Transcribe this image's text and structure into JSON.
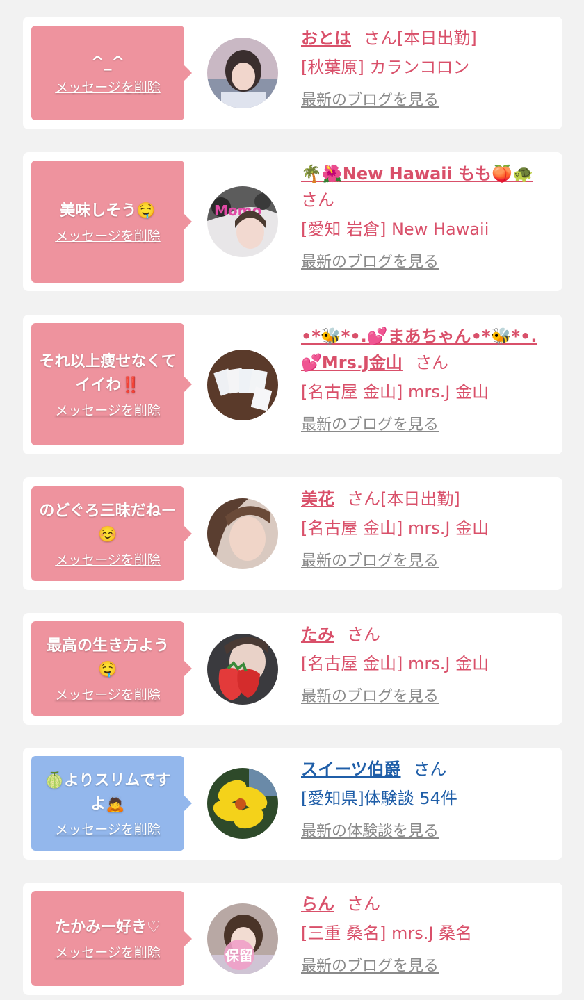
{
  "delete_label": "メッセージを削除",
  "colors": {
    "pink_bubble": "#ee939e",
    "blue_bubble": "#93b7ec",
    "pink_text": "#d9506a",
    "blue_text": "#1f5ea8",
    "link_gray": "#8a8a8a"
  },
  "cards": [
    {
      "message": "^_^",
      "name": "おとは",
      "suffix": "さん[本日出勤]",
      "shop": "[秋葉原] カランコロン",
      "blog": "最新のブログを見る",
      "theme": "pink",
      "avatar": "photo-girl-icon"
    },
    {
      "message": "美味しそう🤤",
      "name": "🌴🌺New Hawaii もも🍑🐢",
      "suffix": "さん",
      "shop": "[愛知 岩倉] New Hawaii",
      "blog": "最新のブログを見る",
      "theme": "pink",
      "avatar": "photo-mono-icon"
    },
    {
      "message": "それ以上痩せなくてイイわ‼️",
      "name": "•*🐝*•.💕まあちゃん•*🐝*•.💕Mrs.J金山",
      "suffix": "さん",
      "shop": "[名古屋 金山] mrs.J 金山",
      "blog": "最新のブログを見る",
      "theme": "pink",
      "avatar": "photo-cards-icon"
    },
    {
      "message": "のどぐろ三昧だねー☺️",
      "name": "美花",
      "suffix": "さん[本日出勤]",
      "shop": "[名古屋 金山] mrs.J 金山",
      "blog": "最新のブログを見る",
      "theme": "pink",
      "avatar": "photo-woman-icon"
    },
    {
      "message": "最高の生き方よう🤤",
      "name": "たみ",
      "suffix": "さん",
      "shop": "[名古屋 金山] mrs.J 金山",
      "blog": "最新のブログを見る",
      "theme": "pink",
      "avatar": "photo-strawberry-icon"
    },
    {
      "message": "🍈よりスリムですよ🙇",
      "name": "スイーツ伯爵",
      "suffix": "さん",
      "shop": "[愛知県]体験談 54件",
      "blog": "最新の体験談を見る",
      "theme": "blue",
      "avatar": "photo-flower-icon"
    },
    {
      "message": "たかみー好き♡",
      "name": "らん",
      "suffix": "さん",
      "shop": "[三重 桑名] mrs.J 桑名",
      "blog": "最新のブログを見る",
      "theme": "pink",
      "avatar": "photo-hold-icon",
      "avatar_stamp": "保留"
    }
  ]
}
